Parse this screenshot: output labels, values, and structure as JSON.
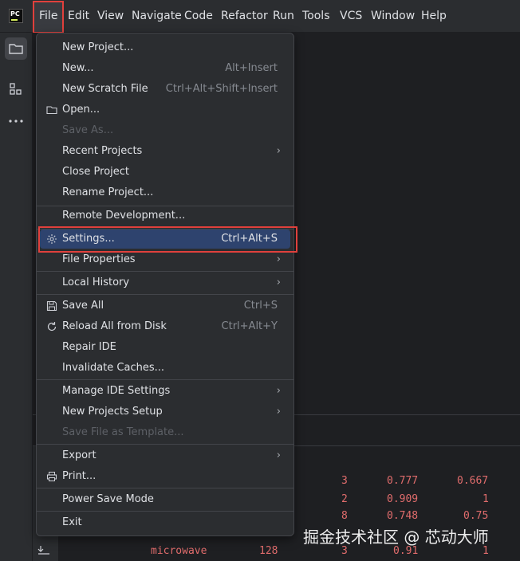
{
  "app": {
    "logo_text": "PC",
    "menus": [
      "File",
      "Edit",
      "View",
      "Navigate",
      "Code",
      "Refactor",
      "Run",
      "Tools",
      "VCS",
      "Window",
      "Help"
    ]
  },
  "file_menu": {
    "items": [
      {
        "label": "New Project...",
        "shortcut": "",
        "submenu": false,
        "disabled": false,
        "icon": ""
      },
      {
        "label": "New...",
        "shortcut": "Alt+Insert",
        "submenu": false,
        "disabled": false,
        "icon": ""
      },
      {
        "label": "New Scratch File",
        "shortcut": "Ctrl+Alt+Shift+Insert",
        "submenu": false,
        "disabled": false,
        "icon": ""
      },
      {
        "label": "Open...",
        "shortcut": "",
        "submenu": false,
        "disabled": false,
        "icon": "folder-icon"
      },
      {
        "label": "Save As...",
        "shortcut": "",
        "submenu": false,
        "disabled": true,
        "icon": ""
      },
      {
        "label": "Recent Projects",
        "shortcut": "",
        "submenu": true,
        "disabled": false,
        "icon": ""
      },
      {
        "label": "Close Project",
        "shortcut": "",
        "submenu": false,
        "disabled": false,
        "icon": ""
      },
      {
        "label": "Rename Project...",
        "shortcut": "",
        "submenu": false,
        "disabled": false,
        "icon": ""
      },
      {
        "label": "Remote Development...",
        "shortcut": "",
        "submenu": false,
        "disabled": false,
        "icon": ""
      },
      {
        "label": "Settings...",
        "shortcut": "Ctrl+Alt+S",
        "submenu": false,
        "disabled": false,
        "icon": "gear-icon",
        "selected": true
      },
      {
        "label": "File Properties",
        "shortcut": "",
        "submenu": true,
        "disabled": false,
        "icon": ""
      },
      {
        "label": "Local History",
        "shortcut": "",
        "submenu": true,
        "disabled": false,
        "icon": ""
      },
      {
        "label": "Save All",
        "shortcut": "Ctrl+S",
        "submenu": false,
        "disabled": false,
        "icon": "save-icon"
      },
      {
        "label": "Reload All from Disk",
        "shortcut": "Ctrl+Alt+Y",
        "submenu": false,
        "disabled": false,
        "icon": "reload-icon"
      },
      {
        "label": "Repair IDE",
        "shortcut": "",
        "submenu": false,
        "disabled": false,
        "icon": ""
      },
      {
        "label": "Invalidate Caches...",
        "shortcut": "",
        "submenu": false,
        "disabled": false,
        "icon": ""
      },
      {
        "label": "Manage IDE Settings",
        "shortcut": "",
        "submenu": true,
        "disabled": false,
        "icon": ""
      },
      {
        "label": "New Projects Setup",
        "shortcut": "",
        "submenu": true,
        "disabled": false,
        "icon": ""
      },
      {
        "label": "Save File as Template...",
        "shortcut": "",
        "submenu": false,
        "disabled": true,
        "icon": ""
      },
      {
        "label": "Export",
        "shortcut": "",
        "submenu": true,
        "disabled": false,
        "icon": ""
      },
      {
        "label": "Print...",
        "shortcut": "",
        "submenu": false,
        "disabled": false,
        "icon": "print-icon"
      },
      {
        "label": "Power Save Mode",
        "shortcut": "",
        "submenu": false,
        "disabled": false,
        "icon": ""
      },
      {
        "label": "Exit",
        "shortcut": "",
        "submenu": false,
        "disabled": false,
        "icon": ""
      }
    ]
  },
  "output_table": {
    "rows": [
      [
        "",
        "",
        "3",
        "0.777",
        "0.667"
      ],
      [
        "",
        "",
        "2",
        "0.909",
        "1"
      ],
      [
        "",
        "",
        "8",
        "0.748",
        "0.75"
      ],
      [
        "microwave",
        "128",
        "3",
        "0.91",
        "1"
      ]
    ]
  },
  "watermark": "掘金技术社区 @ 芯动大师",
  "colors": {
    "background": "#1e1f22",
    "panel": "#2b2d30",
    "selection": "#2e436e",
    "highlight_box": "#e0403c",
    "output_text": "#e06c6c"
  }
}
